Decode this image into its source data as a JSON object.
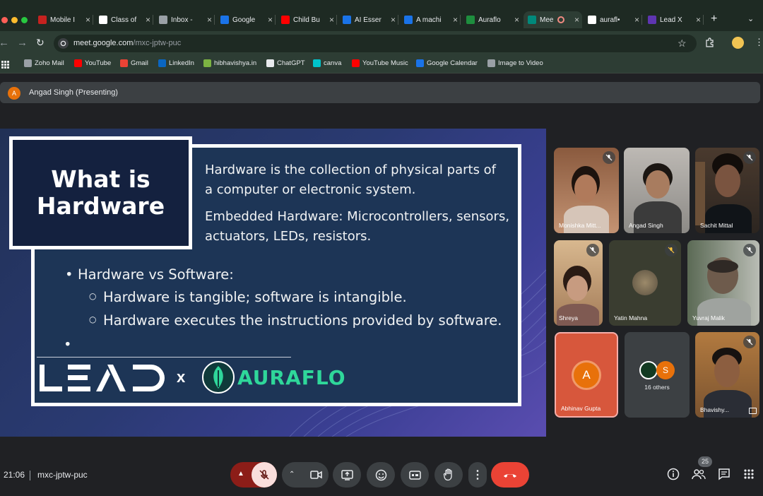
{
  "browser": {
    "tabs": [
      {
        "title": "Mobile I",
        "color": "#c5221f"
      },
      {
        "title": "Class of",
        "color": "#ffffff"
      },
      {
        "title": "Inbox -",
        "color": "#9aa0a6"
      },
      {
        "title": "Google",
        "color": "#1a73e8"
      },
      {
        "title": "Child Bu",
        "color": "#ff0000"
      },
      {
        "title": "AI Esser",
        "color": "#1a73e8"
      },
      {
        "title": "A machi",
        "color": "#1a73e8"
      },
      {
        "title": "Auraflo",
        "color": "#1e8e3e"
      },
      {
        "title": "Mee",
        "color": "#00897b"
      },
      {
        "title": "aurafl•",
        "color": "#ffffff"
      },
      {
        "title": "Lead X",
        "color": "#5e35b1"
      }
    ],
    "url_host": "meet.google.com",
    "url_path": "/mxc-jptw-puc",
    "bookmarks": [
      {
        "label": "Zoho Mail",
        "color": "#9aa0a6"
      },
      {
        "label": "YouTube",
        "color": "#ff0000"
      },
      {
        "label": "Gmail",
        "color": "#ea4335"
      },
      {
        "label": "LinkedIn",
        "color": "#0a66c2"
      },
      {
        "label": "hibhavishya.in",
        "color": "#7cb342"
      },
      {
        "label": "ChatGPT",
        "color": "#e8eaed"
      },
      {
        "label": "canva",
        "color": "#00c4cc"
      },
      {
        "label": "YouTube Music",
        "color": "#ff0000"
      },
      {
        "label": "Google Calendar",
        "color": "#1a73e8"
      },
      {
        "label": "Image to Video",
        "color": "#9aa0a6"
      }
    ]
  },
  "meet": {
    "presenting": {
      "avatar_letter": "A",
      "label": "Angad Singh (Presenting)"
    },
    "slide": {
      "title": "What is Hardware",
      "intro": "Hardware is the collection of physical parts of a computer or electronic system.",
      "embedded": "Embedded Hardware: Microcontrollers, sensors, actuators, LEDs, resistors.",
      "bullet": "Hardware vs Software:",
      "sub_bullets": [
        "Hardware is tangible; software is intangible.",
        "Hardware executes the instructions provided by software."
      ],
      "logo_left": "LEAD",
      "logo_x": "x",
      "logo_right": "AURAFLO"
    },
    "participants": [
      {
        "name": "Monishka Mitt...",
        "muted": true
      },
      {
        "name": "Angad Singh",
        "muted": false
      },
      {
        "name": "Sachit Mittal",
        "muted": true
      },
      {
        "name": "Shreya",
        "muted": true
      },
      {
        "name": "Yatin Mahna",
        "muted": true
      },
      {
        "name": "Yuvraj Malik",
        "muted": true
      },
      {
        "name": "Abhinav Gupta",
        "avatar_letter": "A",
        "muted": false
      },
      {
        "name": "16 others",
        "avatar_letter": "S"
      },
      {
        "name": "Bhavishy...",
        "muted": true
      }
    ],
    "bottom": {
      "time": "21:06",
      "meeting_code": "mxc-jptw-puc",
      "people_count": "25"
    },
    "colors": {
      "end_call": "#ea4335",
      "mic_off": "#f9dedc",
      "abhinav_bg": "#d7573c"
    }
  }
}
